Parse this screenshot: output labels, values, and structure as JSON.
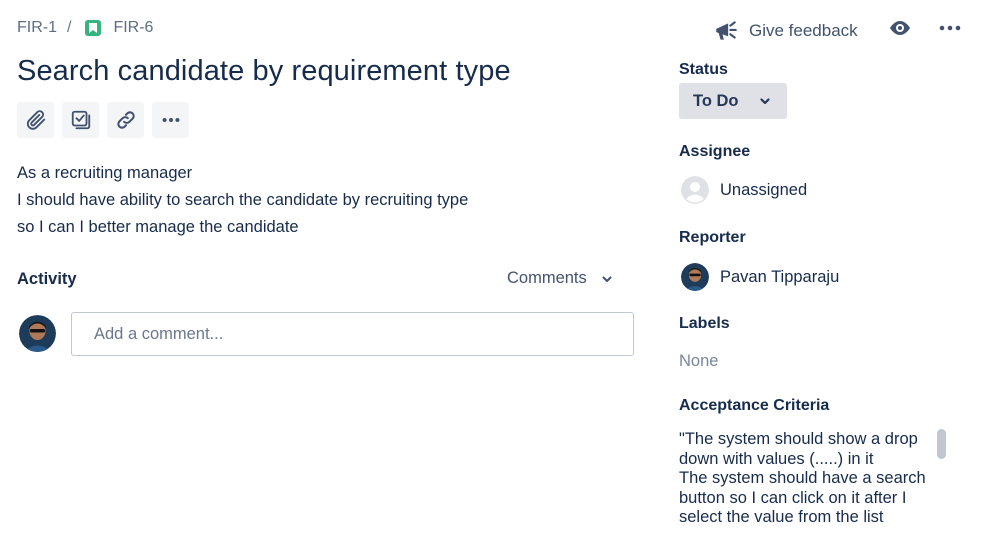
{
  "breadcrumb": {
    "parent": "FIR-1",
    "separator": "/",
    "current": "FIR-6"
  },
  "issue": {
    "title": "Search candidate by requirement type",
    "description": [
      "As a recruiting manager",
      "I should have ability to search the candidate by recruiting type",
      "so I can I better manage the candidate"
    ]
  },
  "toolbar": {
    "icons": [
      "attachment-icon",
      "checklist-icon",
      "link-icon",
      "more-icon"
    ]
  },
  "activity": {
    "label": "Activity",
    "filter_label": "Comments",
    "comment_placeholder": "Add a comment..."
  },
  "header": {
    "feedback_label": "Give feedback"
  },
  "sidebar": {
    "status": {
      "label": "Status",
      "value": "To Do"
    },
    "assignee": {
      "label": "Assignee",
      "value": "Unassigned"
    },
    "reporter": {
      "label": "Reporter",
      "value": "Pavan Tipparaju"
    },
    "labels": {
      "label": "Labels",
      "value": "None"
    },
    "acceptance": {
      "label": "Acceptance Criteria",
      "value": "\"The system should show a drop\ndown with values (.....) in it\nThe system should have a search\nbutton so I can click on it after I\nselect the value from the list"
    }
  },
  "colors": {
    "story": "#36b37e",
    "status_bg": "#dfe1e6",
    "text": "#172b4d",
    "muted": "#5e6c84"
  }
}
